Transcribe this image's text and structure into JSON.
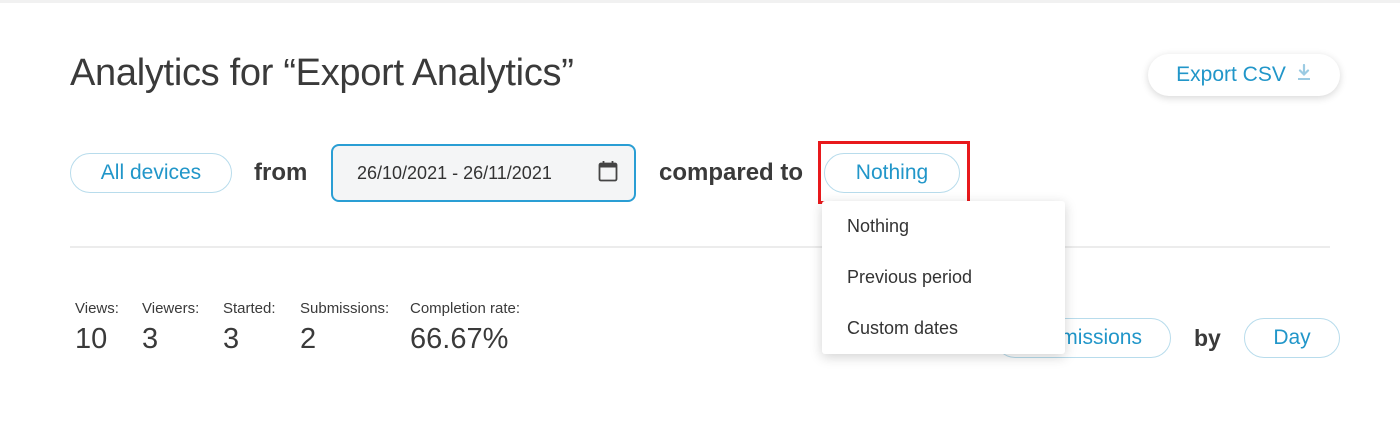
{
  "header": {
    "title": "Analytics for “Export Analytics”",
    "export_label": "Export CSV",
    "export_icon": "download-icon"
  },
  "filters": {
    "device_label": "All devices",
    "from_label": "from",
    "date_range": "26/10/2021 - 26/11/2021",
    "date_icon": "calendar-icon",
    "compared_label": "compared to",
    "compared_value": "Nothing"
  },
  "dropdown": {
    "items": [
      "Nothing",
      "Previous period",
      "Custom dates"
    ]
  },
  "stats": [
    {
      "label": "Views:",
      "value": "10"
    },
    {
      "label": "Viewers:",
      "value": "3"
    },
    {
      "label": "Started:",
      "value": "3"
    },
    {
      "label": "Submissions:",
      "value": "2"
    },
    {
      "label": "Completion rate:",
      "value": "66.67%"
    }
  ],
  "chart_controls": {
    "metric_label": "Submissions",
    "by_label": "by",
    "period_label": "Day"
  },
  "colors": {
    "accent": "#2196c9",
    "highlight": "#e8191c"
  }
}
